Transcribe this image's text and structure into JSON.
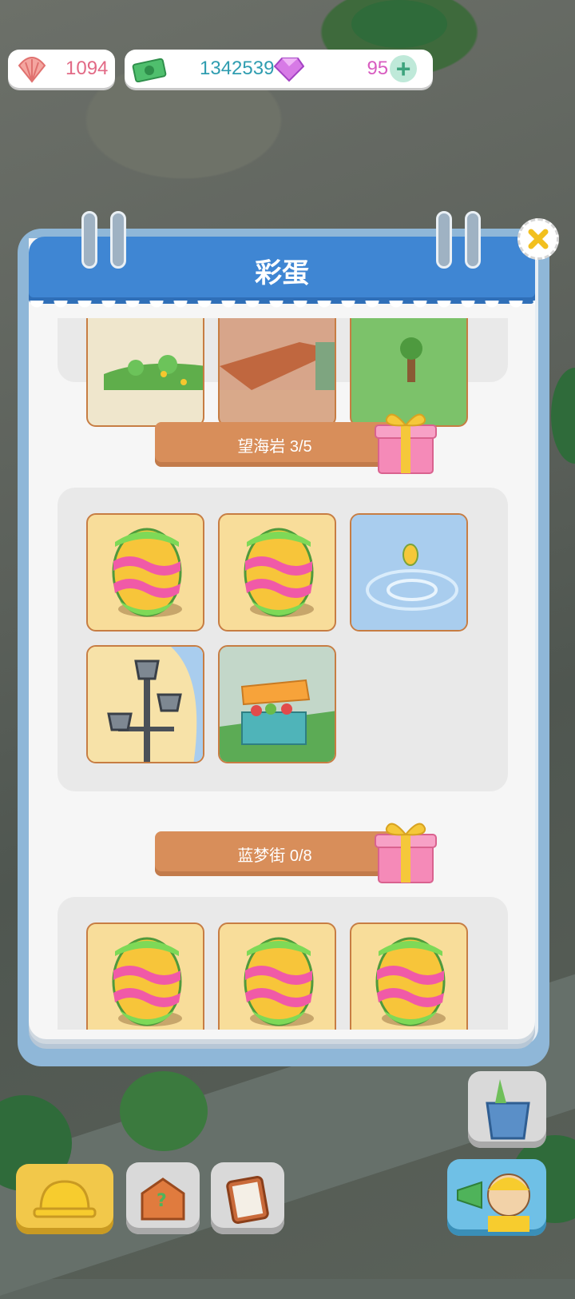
{
  "resources": {
    "shells": "1094",
    "cash": "1342539",
    "gems": "95",
    "shell_icon": "seashell-icon",
    "cash_icon": "banknote-icon",
    "gem_icon": "gem-icon",
    "add_icon": "plus-icon"
  },
  "dialog": {
    "title": "彩蛋",
    "close_icon": "close-icon"
  },
  "sections": [
    {
      "label": "望海岩 3/5",
      "tiles": [
        "flower-garden",
        "stone-steps",
        "tree",
        "easter-egg",
        "easter-egg",
        "fish-splash",
        "street-lamp",
        "fruit-stall"
      ]
    },
    {
      "label": "蓝梦街 0/8",
      "tiles": [
        "easter-egg",
        "easter-egg",
        "easter-egg"
      ]
    }
  ],
  "colors": {
    "header": "#3f86d3",
    "banner": "#d88e5a",
    "tile_border": "#c77d43",
    "shell_count": "#e26a86",
    "cash_count": "#2f9db0",
    "gem_count": "#d85cc0"
  },
  "bottom_bar": [
    "hardhat-icon",
    "toolbox-icon",
    "clipboard-icon",
    "announcer-icon"
  ]
}
